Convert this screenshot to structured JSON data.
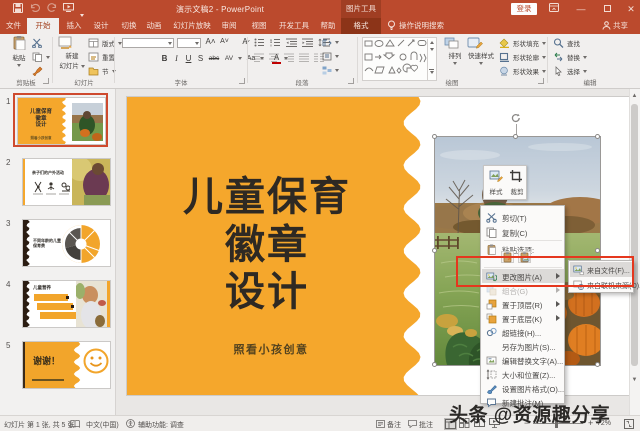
{
  "window": {
    "title": "演示文稿2 - PowerPoint",
    "contextual_tool_label": "图片工具",
    "sign_in_label": "登录"
  },
  "tabs": {
    "items": [
      "文件",
      "开始",
      "插入",
      "设计",
      "切换",
      "动画",
      "幻灯片放映",
      "审阅",
      "视图",
      "开发工具",
      "帮助"
    ],
    "selected": "开始",
    "contextual_tab": "格式",
    "tell_me": "操作说明搜索",
    "share": "共享"
  },
  "ribbon": {
    "paste": "粘贴",
    "clipboard_group": "剪贴板",
    "new_slide_1": "新建",
    "new_slide_2": "幻灯片",
    "layout": "版式",
    "reset": "重置",
    "section": "节",
    "slides_group": "幻灯片",
    "bold": "B",
    "italic": "I",
    "underline": "U",
    "strike": "S",
    "clear_fmt": "abc",
    "char_space": "AV",
    "change_case": "Aa",
    "font_color": "A",
    "font_group": "字体",
    "paragraph_group": "段落",
    "arrange": "排列",
    "quick_styles": "快速样式",
    "shape_fill": "形状填充",
    "shape_outline": "形状轮廓",
    "shape_effects": "形状效果",
    "drawing_group": "绘图",
    "find": "查找",
    "replace": "替换",
    "select": "选择",
    "editing_group": "编辑"
  },
  "thumbnails": {
    "numbers": [
      "1",
      "2",
      "3",
      "4",
      "5"
    ],
    "slide1": {
      "title1": "儿童保育",
      "title2": "徽章",
      "title3": "设计",
      "subtitle": "照看小孩创意"
    },
    "slide2": {
      "title": "亲子们的户外活动"
    },
    "slide3": {
      "title1": "不同年龄的儿童",
      "title2": "保育费"
    },
    "slide4": {
      "title": "儿童营养"
    },
    "slide5": {
      "title": "谢谢！"
    }
  },
  "slide": {
    "title_line1": "儿童保育",
    "title_line2": "徽章",
    "title_line3": "设计",
    "subtitle": "照看小孩创意"
  },
  "mini_toolbar": {
    "styles": "样式",
    "crop": "裁剪"
  },
  "context_menu": {
    "cut": "剪切(T)",
    "copy": "复制(C)",
    "paste_options": "粘贴选项:",
    "change_picture": "更改图片(A)",
    "group": "组合(G)",
    "bring_to_front": "置于顶层(R)",
    "send_to_back": "置于底层(K)",
    "hyperlink": "超链接(H)...",
    "save_as_picture": "另存为图片(S)...",
    "edit_alt_text": "编辑替换文字(A)...",
    "size_position": "大小和位置(Z)...",
    "format_picture": "设置图片格式(O)...",
    "new_comment": "新建批注(M)"
  },
  "submenu": {
    "from_file": "来自文件(F)...",
    "from_online": "来自联机来源(O)..."
  },
  "status": {
    "slide_indicator": "幻灯片 第 1 张, 共 5 张",
    "language": "中文(中国)",
    "accessibility": "辅助功能: 调查",
    "notes": "备注",
    "comments": "批注",
    "zoom_level": "72%"
  },
  "watermark": "头条 @资源趣分享",
  "colors": {
    "brand": "#BB4A2D",
    "contextual_band": "#A03E23",
    "contextual_tab": "#8C3418",
    "ribbon_bg": "#F1EFEE",
    "slide_yellow": "#F5A72C",
    "annotation_red": "#E5371E",
    "selection_border": "#CE4A2E"
  }
}
